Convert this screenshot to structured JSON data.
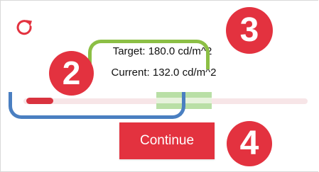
{
  "panel": {
    "reset_icon": "refresh-icon",
    "target_text": "Target: 180.0 cd/m^2",
    "current_text": "Current: 132.0 cd/m^2",
    "continue_label": "Continue"
  },
  "meter": {
    "target_value": 180.0,
    "current_value": 132.0,
    "unit": "cd/m^2"
  },
  "annotations": {
    "marker_2": "2",
    "marker_3": "3",
    "marker_4": "4"
  },
  "colors": {
    "accent_red": "#e3323f",
    "target_green": "#8cbf45",
    "bracket_blue": "#4a7fc1"
  }
}
